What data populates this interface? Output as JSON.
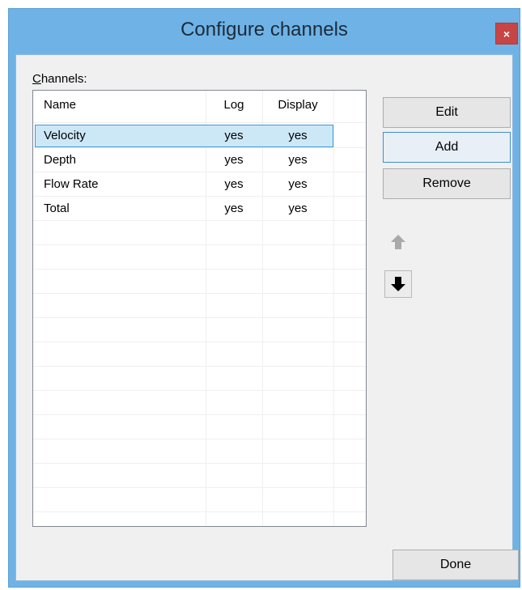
{
  "window": {
    "title": "Configure channels",
    "close_glyph": "×"
  },
  "channels": {
    "label_mnemonic": "C",
    "label_rest": "hannels:",
    "columns": [
      "Name",
      "Log",
      "Display"
    ],
    "rows": [
      {
        "name": "Velocity",
        "log": "yes",
        "display": "yes"
      },
      {
        "name": "Depth",
        "log": "yes",
        "display": "yes"
      },
      {
        "name": "Flow Rate",
        "log": "yes",
        "display": "yes"
      },
      {
        "name": "Total",
        "log": "yes",
        "display": "yes"
      }
    ],
    "selected_row": "Velocity"
  },
  "buttons": {
    "edit": "Edit",
    "add": "Add",
    "remove": "Remove",
    "done": "Done"
  },
  "icons": {
    "move_up": "arrow-up-icon",
    "move_down": "arrow-down-icon",
    "close": "close-icon"
  },
  "colors": {
    "title_bar": "#6fb3e6",
    "selection": "#cce8f7",
    "close_button": "#c74545"
  }
}
